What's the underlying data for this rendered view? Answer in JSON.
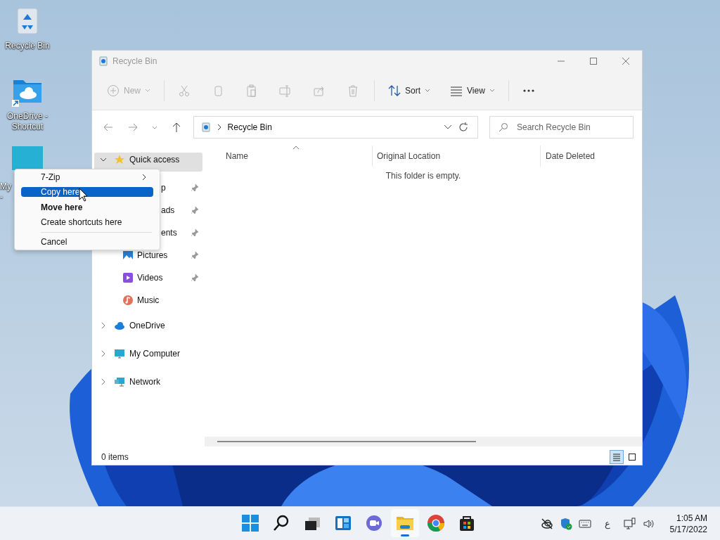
{
  "desktop_icons": [
    {
      "kind": "recycle",
      "lines": [
        "Recycle Bin"
      ]
    },
    {
      "kind": "onedrive",
      "lines": [
        "OneDrive -",
        "Shortcut"
      ]
    },
    {
      "kind": "monitor",
      "lines": [
        "My",
        "-"
      ]
    }
  ],
  "window": {
    "title": "Recycle Bin",
    "active": false,
    "toolbar": [
      {
        "kind": "new",
        "label": "New",
        "disabled": true
      },
      {
        "kind": "cut",
        "disabled": true
      },
      {
        "kind": "copy",
        "disabled": true
      },
      {
        "kind": "paste",
        "disabled": true
      },
      {
        "kind": "rename",
        "disabled": true
      },
      {
        "kind": "share",
        "disabled": true
      },
      {
        "kind": "delete",
        "disabled": true
      },
      {
        "kind": "sort",
        "label": "Sort",
        "disabled": false
      },
      {
        "kind": "view",
        "label": "View",
        "disabled": false
      },
      {
        "kind": "more",
        "disabled": false
      }
    ],
    "address": {
      "path": "Recycle Bin"
    },
    "search": {
      "placeholder": "Search Recycle Bin"
    },
    "sidebar": [
      {
        "kind": "star",
        "label": "Quick access",
        "selected": true,
        "expanded": true,
        "children": [
          {
            "kind": "covered",
            "label": "p",
            "pinned": true
          },
          {
            "kind": "covered",
            "label": "ads",
            "pinned": true
          },
          {
            "kind": "covered",
            "label": "ents",
            "pinned": true
          },
          {
            "kind": "pictures",
            "label": "Pictures",
            "pinned": true
          },
          {
            "kind": "videos",
            "label": "Videos",
            "pinned": true
          },
          {
            "kind": "music",
            "label": "Music",
            "pinned": false
          }
        ]
      },
      {
        "kind": "cloud",
        "label": "OneDrive",
        "selected": false,
        "expanded": false
      },
      {
        "kind": "monitor",
        "label": "My Computer",
        "selected": false,
        "expanded": false
      },
      {
        "kind": "network",
        "label": "Network",
        "selected": false,
        "expanded": false
      }
    ],
    "columns": [
      {
        "label": "Name",
        "sorted": true
      },
      {
        "label": "Original Location",
        "sorted": false
      },
      {
        "label": "Date Deleted",
        "sorted": false
      }
    ],
    "empty_message": "This folder is empty.",
    "status": "0 items",
    "view_buttons": [
      {
        "kind": "details",
        "selected": true
      },
      {
        "kind": "tiles",
        "selected": false
      }
    ]
  },
  "context_menu": [
    {
      "kind": "submenu",
      "label": "7-Zip",
      "selected": false
    },
    {
      "kind": "item",
      "label": "Copy here",
      "selected": true
    },
    {
      "kind": "default",
      "label": "Move here",
      "selected": false
    },
    {
      "kind": "item",
      "label": "Create shortcuts here",
      "selected": false
    },
    {
      "kind": "separator"
    },
    {
      "kind": "item",
      "label": "Cancel",
      "selected": false
    }
  ],
  "taskbar": {
    "apps": [
      {
        "kind": "start",
        "active": false
      },
      {
        "kind": "search",
        "active": false
      },
      {
        "kind": "taskview",
        "active": false
      },
      {
        "kind": "widgets",
        "active": false
      },
      {
        "kind": "chat",
        "active": false
      },
      {
        "kind": "explorer",
        "active": true
      },
      {
        "kind": "chrome",
        "active": false
      },
      {
        "kind": "store",
        "active": false
      }
    ],
    "tray": [
      {
        "kind": "cloud-off"
      },
      {
        "kind": "security"
      },
      {
        "kind": "keyboard"
      },
      {
        "kind": "language",
        "text": "ع"
      },
      {
        "kind": "network"
      },
      {
        "kind": "volume"
      }
    ],
    "time": "1:05 AM",
    "date": "5/17/2022"
  }
}
